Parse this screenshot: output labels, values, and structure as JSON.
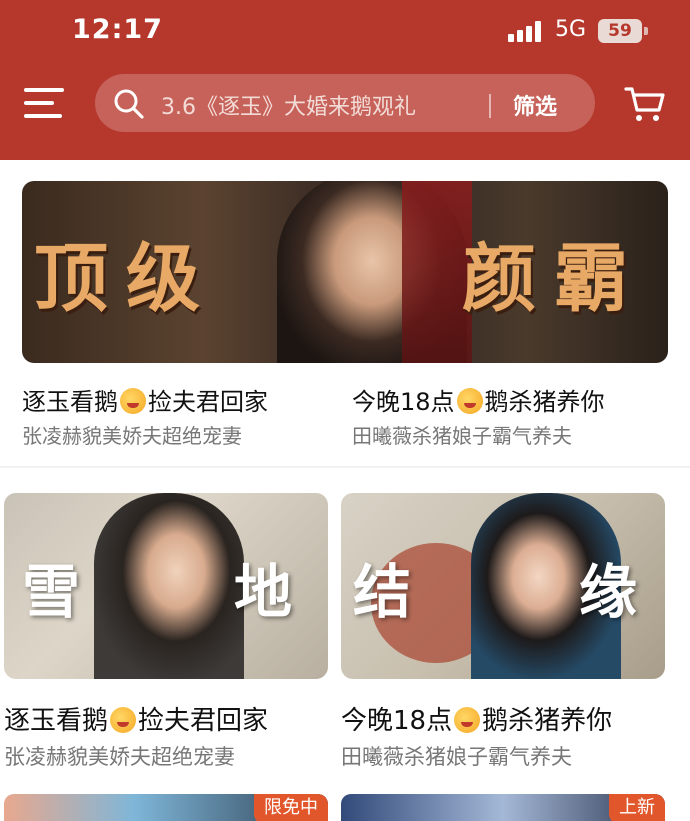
{
  "status_bar": {
    "time": "12:17",
    "network": "5G",
    "battery": "59"
  },
  "header": {
    "search_placeholder": "3.6《逐玉》大婚来鹅观礼",
    "filter_label": "筛选"
  },
  "banner": {
    "left_text": "顶级",
    "right_text": "颜霸"
  },
  "cards": [
    {
      "title_before": "逐玉看鹅",
      "title_after": "捡夫君回家",
      "subtitle": "张凌赫貌美娇夫超绝宠妻"
    },
    {
      "title_before": "今晚18点",
      "title_after": "鹅杀猪养你",
      "subtitle": "田曦薇杀猪娘子霸气养夫"
    },
    {
      "title_before": "逐玉看鹅",
      "title_after": "捡夫君回家",
      "subtitle": "张凌赫貌美娇夫超绝宠妻",
      "thumb_left": "雪",
      "thumb_right": "地"
    },
    {
      "title_before": "今晚18点",
      "title_after": "鹅杀猪养你",
      "subtitle": "田曦薇杀猪娘子霸气养夫",
      "thumb_left": "结",
      "thumb_right": "缘"
    }
  ],
  "bottom_tags": {
    "left": "限免中",
    "right": "上新"
  },
  "colors": {
    "header_bg": "#b6372b",
    "tag_bg": "#e2562b",
    "banner_text": "#e9a966"
  }
}
